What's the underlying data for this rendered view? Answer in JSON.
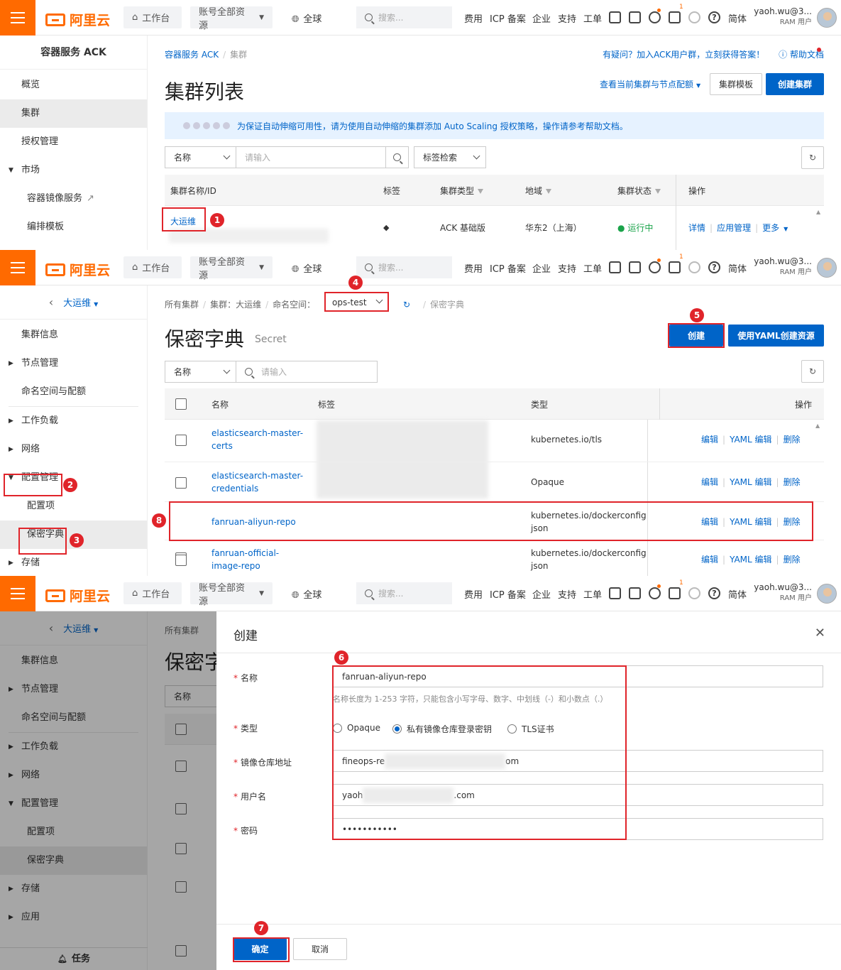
{
  "topbar": {
    "logo_text": "阿里云",
    "workbench": "工作台",
    "resources": "账号全部资源",
    "region": "全球",
    "search_placeholder": "搜索...",
    "links": [
      "费用",
      "ICP 备案",
      "企业",
      "支持",
      "工单"
    ],
    "lang": "简体",
    "badge_count": "1",
    "user_name": "yaoh.wu@3...",
    "user_role": "RAM 用户"
  },
  "panel1": {
    "sidebar_title": "容器服务 ACK",
    "sidebar_items": [
      "概览",
      "集群",
      "授权管理",
      "市场",
      "容器镜像服务",
      "编排模板"
    ],
    "breadcrumb": [
      "容器服务 ACK",
      "集群"
    ],
    "help_text": "有疑问？加入ACK用户群，立刻获得答案！",
    "help_doc": "帮助文档",
    "title": "集群列表",
    "quota_link": "查看当前集群与节点配额",
    "template_btn": "集群模板",
    "create_btn": "创建集群",
    "banner": "为保证自动伸缩可用性，请为使用自动伸缩的集群添加 Auto Scaling 授权策略，操作请参考帮助文档。",
    "filter_select": "名称",
    "filter_placeholder": "请输入",
    "tag_search": "标签检索",
    "columns": [
      "集群名称/ID",
      "标签",
      "集群类型",
      "地域",
      "集群状态",
      "操作"
    ],
    "row": {
      "name": "大运维",
      "type": "ACK 基础版",
      "region": "华东2（上海）",
      "status": "运行中",
      "ops": [
        "详情",
        "应用管理",
        "更多"
      ]
    }
  },
  "panel2": {
    "cluster": "大运维",
    "sidebar_items": [
      "集群信息",
      "节点管理",
      "命名空间与配额",
      "工作负载",
      "网络",
      "配置管理",
      "配置项",
      "保密字典",
      "存储"
    ],
    "breadcrumb": [
      "所有集群",
      "集群：大运维",
      "命名空间："
    ],
    "namespace": "ops-test",
    "breadcrumb_last": "保密字典",
    "title": "保密字典",
    "subtitle": "Secret",
    "create_btn": "创建",
    "yaml_btn": "使用YAML创建资源",
    "filter_select": "名称",
    "filter_placeholder": "请输入",
    "columns": [
      "名称",
      "标签",
      "类型",
      "操作"
    ],
    "rows": [
      {
        "name1": "elasticsearch-master-",
        "name2": "certs",
        "type1": "kubernetes.io/tls",
        "type2": ""
      },
      {
        "name1": "elasticsearch-master-",
        "name2": "credentials",
        "type1": "Opaque",
        "type2": ""
      },
      {
        "name1": "fanruan-aliyun-repo",
        "name2": "",
        "type1": "kubernetes.io/dockerconfig",
        "type2": "json"
      },
      {
        "name1": "fanruan-official-",
        "name2": "image-repo",
        "type1": "kubernetes.io/dockerconfig",
        "type2": "json"
      }
    ],
    "ops": [
      "编辑",
      "YAML 编辑",
      "删除"
    ]
  },
  "panel3": {
    "cluster": "大运维",
    "sidebar_items": [
      "集群信息",
      "节点管理",
      "命名空间与配额",
      "工作负载",
      "网络",
      "配置管理",
      "配置项",
      "保密字典",
      "存储",
      "应用"
    ],
    "task": "任务",
    "bg_breadcrumb": "所有集群",
    "bg_title": "保密字",
    "bg_filter": "名称",
    "drawer": {
      "title": "创建",
      "name_label": "名称",
      "name_value": "fanruan-aliyun-repo",
      "name_hint": "名称长度为 1-253 字符，只能包含小写字母、数字、中划线（-）和小数点（.）",
      "type_label": "类型",
      "types": [
        "Opaque",
        "私有镜像仓库登录密钥",
        "TLS证书"
      ],
      "registry_label": "镜像仓库地址",
      "registry_start": "fineops-re",
      "registry_end": "om",
      "user_label": "用户名",
      "user_start": "yaoh",
      "user_end": ".com",
      "pwd_label": "密码",
      "pwd_value": "•••••••••••",
      "ok": "确定",
      "cancel": "取消"
    }
  },
  "markers": [
    "1",
    "2",
    "3",
    "4",
    "5",
    "6",
    "7",
    "8"
  ]
}
